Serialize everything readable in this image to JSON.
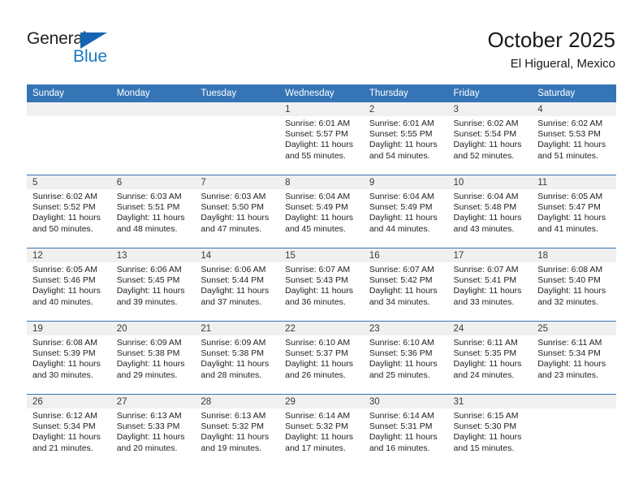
{
  "brand": {
    "name_top": "General",
    "name_bottom": "Blue",
    "triangle_color": "#1565b0",
    "top_color": "#231f20",
    "bottom_color": "#1779c4"
  },
  "header": {
    "title": "October 2025",
    "subtitle": "El Higueral, Mexico"
  },
  "theme": {
    "header_bg": "#3575b5",
    "date_band_bg": "#f0f0f0",
    "cell_bg": "#ffffff",
    "row_divider": "#3575b5",
    "text": "#222222"
  },
  "weekday_headers": [
    "Sunday",
    "Monday",
    "Tuesday",
    "Wednesday",
    "Thursday",
    "Friday",
    "Saturday"
  ],
  "weeks": [
    [
      {
        "day": "",
        "empty": true
      },
      {
        "day": "",
        "empty": true
      },
      {
        "day": "",
        "empty": true
      },
      {
        "day": "1",
        "sunrise": "Sunrise: 6:01 AM",
        "sunset": "Sunset: 5:57 PM",
        "daylight_line1": "Daylight: 11 hours",
        "daylight_line2": "and 55 minutes."
      },
      {
        "day": "2",
        "sunrise": "Sunrise: 6:01 AM",
        "sunset": "Sunset: 5:55 PM",
        "daylight_line1": "Daylight: 11 hours",
        "daylight_line2": "and 54 minutes."
      },
      {
        "day": "3",
        "sunrise": "Sunrise: 6:02 AM",
        "sunset": "Sunset: 5:54 PM",
        "daylight_line1": "Daylight: 11 hours",
        "daylight_line2": "and 52 minutes."
      },
      {
        "day": "4",
        "sunrise": "Sunrise: 6:02 AM",
        "sunset": "Sunset: 5:53 PM",
        "daylight_line1": "Daylight: 11 hours",
        "daylight_line2": "and 51 minutes."
      }
    ],
    [
      {
        "day": "5",
        "sunrise": "Sunrise: 6:02 AM",
        "sunset": "Sunset: 5:52 PM",
        "daylight_line1": "Daylight: 11 hours",
        "daylight_line2": "and 50 minutes."
      },
      {
        "day": "6",
        "sunrise": "Sunrise: 6:03 AM",
        "sunset": "Sunset: 5:51 PM",
        "daylight_line1": "Daylight: 11 hours",
        "daylight_line2": "and 48 minutes."
      },
      {
        "day": "7",
        "sunrise": "Sunrise: 6:03 AM",
        "sunset": "Sunset: 5:50 PM",
        "daylight_line1": "Daylight: 11 hours",
        "daylight_line2": "and 47 minutes."
      },
      {
        "day": "8",
        "sunrise": "Sunrise: 6:04 AM",
        "sunset": "Sunset: 5:49 PM",
        "daylight_line1": "Daylight: 11 hours",
        "daylight_line2": "and 45 minutes."
      },
      {
        "day": "9",
        "sunrise": "Sunrise: 6:04 AM",
        "sunset": "Sunset: 5:49 PM",
        "daylight_line1": "Daylight: 11 hours",
        "daylight_line2": "and 44 minutes."
      },
      {
        "day": "10",
        "sunrise": "Sunrise: 6:04 AM",
        "sunset": "Sunset: 5:48 PM",
        "daylight_line1": "Daylight: 11 hours",
        "daylight_line2": "and 43 minutes."
      },
      {
        "day": "11",
        "sunrise": "Sunrise: 6:05 AM",
        "sunset": "Sunset: 5:47 PM",
        "daylight_line1": "Daylight: 11 hours",
        "daylight_line2": "and 41 minutes."
      }
    ],
    [
      {
        "day": "12",
        "sunrise": "Sunrise: 6:05 AM",
        "sunset": "Sunset: 5:46 PM",
        "daylight_line1": "Daylight: 11 hours",
        "daylight_line2": "and 40 minutes."
      },
      {
        "day": "13",
        "sunrise": "Sunrise: 6:06 AM",
        "sunset": "Sunset: 5:45 PM",
        "daylight_line1": "Daylight: 11 hours",
        "daylight_line2": "and 39 minutes."
      },
      {
        "day": "14",
        "sunrise": "Sunrise: 6:06 AM",
        "sunset": "Sunset: 5:44 PM",
        "daylight_line1": "Daylight: 11 hours",
        "daylight_line2": "and 37 minutes."
      },
      {
        "day": "15",
        "sunrise": "Sunrise: 6:07 AM",
        "sunset": "Sunset: 5:43 PM",
        "daylight_line1": "Daylight: 11 hours",
        "daylight_line2": "and 36 minutes."
      },
      {
        "day": "16",
        "sunrise": "Sunrise: 6:07 AM",
        "sunset": "Sunset: 5:42 PM",
        "daylight_line1": "Daylight: 11 hours",
        "daylight_line2": "and 34 minutes."
      },
      {
        "day": "17",
        "sunrise": "Sunrise: 6:07 AM",
        "sunset": "Sunset: 5:41 PM",
        "daylight_line1": "Daylight: 11 hours",
        "daylight_line2": "and 33 minutes."
      },
      {
        "day": "18",
        "sunrise": "Sunrise: 6:08 AM",
        "sunset": "Sunset: 5:40 PM",
        "daylight_line1": "Daylight: 11 hours",
        "daylight_line2": "and 32 minutes."
      }
    ],
    [
      {
        "day": "19",
        "sunrise": "Sunrise: 6:08 AM",
        "sunset": "Sunset: 5:39 PM",
        "daylight_line1": "Daylight: 11 hours",
        "daylight_line2": "and 30 minutes."
      },
      {
        "day": "20",
        "sunrise": "Sunrise: 6:09 AM",
        "sunset": "Sunset: 5:38 PM",
        "daylight_line1": "Daylight: 11 hours",
        "daylight_line2": "and 29 minutes."
      },
      {
        "day": "21",
        "sunrise": "Sunrise: 6:09 AM",
        "sunset": "Sunset: 5:38 PM",
        "daylight_line1": "Daylight: 11 hours",
        "daylight_line2": "and 28 minutes."
      },
      {
        "day": "22",
        "sunrise": "Sunrise: 6:10 AM",
        "sunset": "Sunset: 5:37 PM",
        "daylight_line1": "Daylight: 11 hours",
        "daylight_line2": "and 26 minutes."
      },
      {
        "day": "23",
        "sunrise": "Sunrise: 6:10 AM",
        "sunset": "Sunset: 5:36 PM",
        "daylight_line1": "Daylight: 11 hours",
        "daylight_line2": "and 25 minutes."
      },
      {
        "day": "24",
        "sunrise": "Sunrise: 6:11 AM",
        "sunset": "Sunset: 5:35 PM",
        "daylight_line1": "Daylight: 11 hours",
        "daylight_line2": "and 24 minutes."
      },
      {
        "day": "25",
        "sunrise": "Sunrise: 6:11 AM",
        "sunset": "Sunset: 5:34 PM",
        "daylight_line1": "Daylight: 11 hours",
        "daylight_line2": "and 23 minutes."
      }
    ],
    [
      {
        "day": "26",
        "sunrise": "Sunrise: 6:12 AM",
        "sunset": "Sunset: 5:34 PM",
        "daylight_line1": "Daylight: 11 hours",
        "daylight_line2": "and 21 minutes."
      },
      {
        "day": "27",
        "sunrise": "Sunrise: 6:13 AM",
        "sunset": "Sunset: 5:33 PM",
        "daylight_line1": "Daylight: 11 hours",
        "daylight_line2": "and 20 minutes."
      },
      {
        "day": "28",
        "sunrise": "Sunrise: 6:13 AM",
        "sunset": "Sunset: 5:32 PM",
        "daylight_line1": "Daylight: 11 hours",
        "daylight_line2": "and 19 minutes."
      },
      {
        "day": "29",
        "sunrise": "Sunrise: 6:14 AM",
        "sunset": "Sunset: 5:32 PM",
        "daylight_line1": "Daylight: 11 hours",
        "daylight_line2": "and 17 minutes."
      },
      {
        "day": "30",
        "sunrise": "Sunrise: 6:14 AM",
        "sunset": "Sunset: 5:31 PM",
        "daylight_line1": "Daylight: 11 hours",
        "daylight_line2": "and 16 minutes."
      },
      {
        "day": "31",
        "sunrise": "Sunrise: 6:15 AM",
        "sunset": "Sunset: 5:30 PM",
        "daylight_line1": "Daylight: 11 hours",
        "daylight_line2": "and 15 minutes."
      },
      {
        "day": "",
        "empty": true
      }
    ]
  ]
}
